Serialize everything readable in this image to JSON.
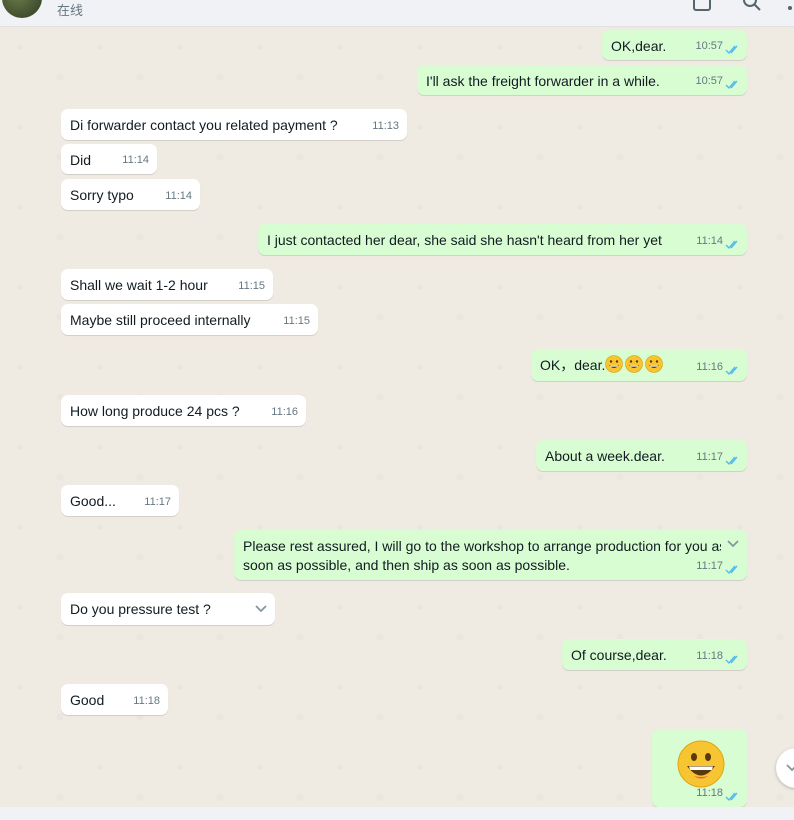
{
  "header": {
    "status": "在线",
    "icons": [
      "video-call-icon",
      "search-icon",
      "menu-icon"
    ]
  },
  "messages": [
    {
      "dir": "out",
      "text": "OK,dear.",
      "time": "10:57",
      "ticks": "read"
    },
    {
      "dir": "out",
      "text": "I'll ask the freight forwarder in a while.",
      "time": "10:57",
      "ticks": "read"
    },
    {
      "dir": "in",
      "text": "Di forwarder contact you related payment ?",
      "time": "11:13"
    },
    {
      "dir": "in",
      "text": "Did",
      "time": "11:14"
    },
    {
      "dir": "in",
      "text": "Sorry typo",
      "time": "11:14"
    },
    {
      "dir": "out",
      "text": "I just contacted her dear, she said she hasn't heard from her yet",
      "time": "11:14",
      "ticks": "read"
    },
    {
      "dir": "in",
      "text": "Shall we wait 1-2 hour",
      "time": "11:15"
    },
    {
      "dir": "in",
      "text": "Maybe still proceed internally",
      "time": "11:15"
    },
    {
      "dir": "out",
      "text": "OK，dear.",
      "time": "11:16",
      "ticks": "read",
      "emojis": 3
    },
    {
      "dir": "in",
      "text": "How long produce 24 pcs ?",
      "time": "11:16"
    },
    {
      "dir": "out",
      "text": "About a week.dear.",
      "time": "11:17",
      "ticks": "read"
    },
    {
      "dir": "in",
      "text": "Good...",
      "time": "11:17"
    },
    {
      "dir": "out",
      "text_line1": "Please rest assured, I will go to the workshop to arrange production for you as",
      "text_line2": "soon as possible, and then ship as soon as possible.",
      "time": "11:17",
      "ticks": "read"
    },
    {
      "dir": "in",
      "text": "Do you pressure test ?",
      "time": ""
    },
    {
      "dir": "out",
      "text": "Of course,dear.",
      "time": "11:18",
      "ticks": "read"
    },
    {
      "dir": "in",
      "text": "Good",
      "time": "11:18"
    },
    {
      "dir": "out",
      "emoji_only": "grinning-face",
      "time": "11:18",
      "ticks": "read"
    }
  ],
  "colors": {
    "incoming": "#ffffff",
    "outgoing": "#d9fdd3",
    "read_tick": "#53bdeb",
    "background": "#efeae2"
  }
}
